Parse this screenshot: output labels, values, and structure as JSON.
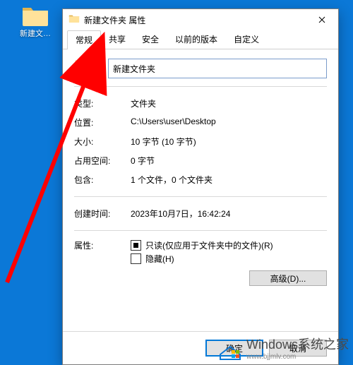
{
  "desktop": {
    "icon_label": "新建文…"
  },
  "window": {
    "title": "新建文件夹 属性",
    "close_char": "✕"
  },
  "tabs": {
    "general": "常规",
    "share": "共享",
    "security": "安全",
    "previous": "以前的版本",
    "custom": "自定义"
  },
  "fields": {
    "name_value": "新建文件夹",
    "type_label": "类型:",
    "type_value": "文件夹",
    "location_label": "位置:",
    "location_value": "C:\\Users\\user\\Desktop",
    "size_label": "大小:",
    "size_value": "10 字节 (10 字节)",
    "ondisk_label": "占用空间:",
    "ondisk_value": "0 字节",
    "contains_label": "包含:",
    "contains_value": "1 个文件，0 个文件夹",
    "created_label": "创建时间:",
    "created_value": "2023年10月7日，16:42:24"
  },
  "attributes": {
    "label": "属性:",
    "readonly_text": "只读(仅应用于文件夹中的文件)(R)",
    "hidden_text": "隐藏(H)",
    "advanced_btn": "高级(D)..."
  },
  "buttons": {
    "ok": "确定",
    "cancel": "取消"
  },
  "watermark": {
    "main": "Windows系统之家",
    "sub": "www.bjjmlv.com"
  }
}
